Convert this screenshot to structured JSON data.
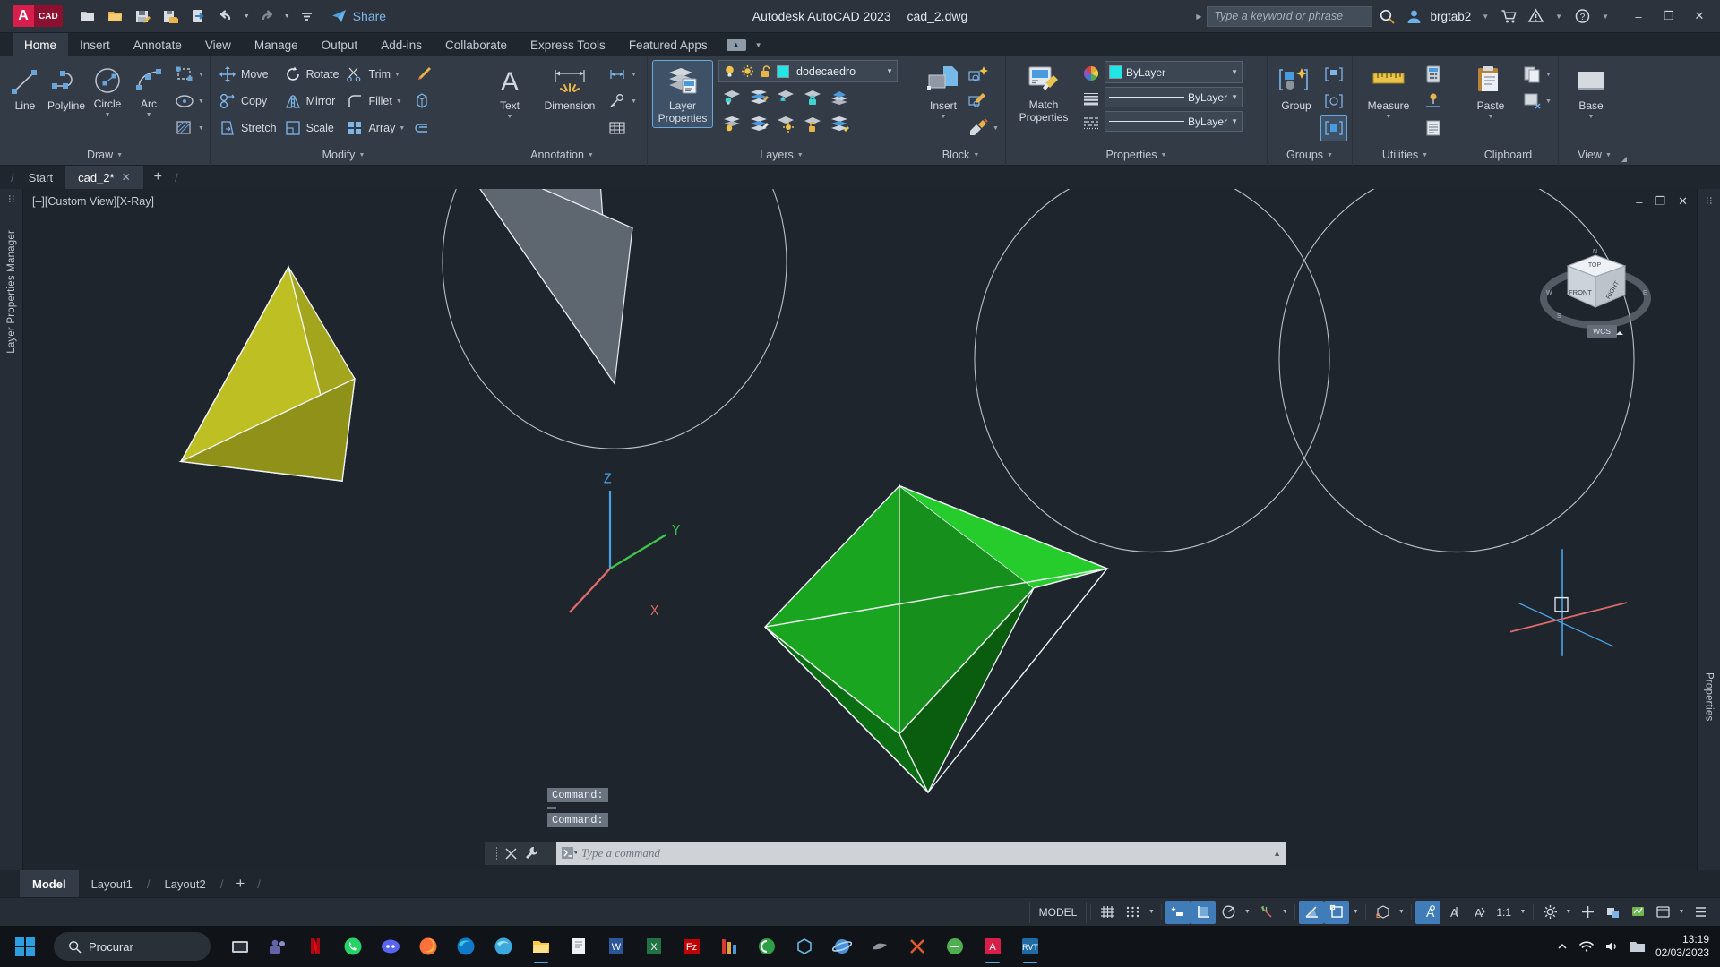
{
  "titlebar": {
    "logo_a": "A",
    "logo_cad": "CAD",
    "quick_access": [
      {
        "name": "new-icon",
        "tip": "New"
      },
      {
        "name": "open-icon",
        "tip": "Open"
      },
      {
        "name": "save-icon",
        "tip": "Save"
      },
      {
        "name": "save-as-icon",
        "tip": "Save As"
      },
      {
        "name": "plot-icon",
        "tip": "Plot"
      },
      {
        "name": "undo-icon",
        "tip": "Undo"
      },
      {
        "name": "redo-icon",
        "tip": "Redo"
      },
      {
        "name": "customize-icon",
        "tip": "Customize"
      }
    ],
    "share_label": "Share",
    "app_title": "Autodesk AutoCAD 2023",
    "file_name": "cad_2.dwg",
    "search_placeholder": "Type a keyword or phrase",
    "search_value": "",
    "user_name": "brgtab2",
    "window_buttons": {
      "minimize": "–",
      "maximize": "❐",
      "close": "✕"
    }
  },
  "ribbon_tabs": [
    {
      "label": "Home",
      "active": true
    },
    {
      "label": "Insert",
      "active": false
    },
    {
      "label": "Annotate",
      "active": false
    },
    {
      "label": "View",
      "active": false
    },
    {
      "label": "Manage",
      "active": false
    },
    {
      "label": "Output",
      "active": false
    },
    {
      "label": "Add-ins",
      "active": false
    },
    {
      "label": "Collaborate",
      "active": false
    },
    {
      "label": "Express Tools",
      "active": false
    },
    {
      "label": "Featured Apps",
      "active": false
    }
  ],
  "ribbon": {
    "draw": {
      "title": "Draw",
      "big": [
        {
          "label": "Line",
          "icon": "line-icon"
        },
        {
          "label": "Polyline",
          "icon": "polyline-icon"
        },
        {
          "label": "Circle",
          "icon": "circle-icon",
          "caret": true
        },
        {
          "label": "Arc",
          "icon": "arc-icon",
          "caret": true
        }
      ],
      "small": [
        {
          "icon": "rectangle-icon",
          "caret": true
        },
        {
          "icon": "ellipse-icon",
          "caret": true
        },
        {
          "icon": "hatch-icon",
          "caret": true
        }
      ]
    },
    "modify": {
      "title": "Modify",
      "items": [
        {
          "label": "Move",
          "icon": "move-icon"
        },
        {
          "label": "Rotate",
          "icon": "rotate-icon"
        },
        {
          "label": "Trim",
          "icon": "trim-icon",
          "caret": true
        },
        {
          "label": "Copy",
          "icon": "copy-icon"
        },
        {
          "label": "Mirror",
          "icon": "mirror-icon"
        },
        {
          "label": "Fillet",
          "icon": "fillet-icon",
          "caret": true
        },
        {
          "label": "Stretch",
          "icon": "stretch-icon"
        },
        {
          "label": "Scale",
          "icon": "scale-icon"
        },
        {
          "label": "Array",
          "icon": "array-icon",
          "caret": true
        }
      ],
      "extra": [
        {
          "icon": "erase-brush-icon"
        },
        {
          "icon": "solid-edit-icon"
        },
        {
          "icon": "join-icon"
        }
      ]
    },
    "annotation": {
      "title": "Annotation",
      "big": [
        {
          "label": "Text",
          "icon": "text-icon",
          "caret": true
        },
        {
          "label": "Dimension",
          "icon": "dimension-icon"
        }
      ],
      "small": [
        {
          "icon": "linear-dim-icon",
          "caret": true
        },
        {
          "icon": "leader-icon",
          "caret": true
        },
        {
          "icon": "table-icon"
        }
      ]
    },
    "layers": {
      "title": "Layers",
      "big": {
        "label": "Layer\nProperties",
        "label1": "Layer",
        "label2": "Properties",
        "icon": "layer-properties-icon",
        "active": true
      },
      "current_layer": "dodecaedro",
      "layer_color": "#22e6e6",
      "toggles": [
        {
          "icon": "lightbulb-icon",
          "state": "on"
        },
        {
          "icon": "sun-icon",
          "state": "on"
        },
        {
          "icon": "unlock-icon",
          "state": "unlocked"
        }
      ],
      "tools_row1": [
        {
          "icon": "layer-off-icon"
        },
        {
          "icon": "layer-isolate-icon"
        },
        {
          "icon": "layer-freeze-icon"
        },
        {
          "icon": "layer-lock-icon"
        },
        {
          "icon": "layer-make-current-icon"
        }
      ],
      "tools_row2": [
        {
          "icon": "layer-on-icon"
        },
        {
          "icon": "layer-unisolate-icon"
        },
        {
          "icon": "layer-thaw-icon"
        },
        {
          "icon": "layer-unlock-icon"
        },
        {
          "icon": "layer-match-icon"
        }
      ]
    },
    "block": {
      "title": "Block",
      "big": {
        "label": "Insert",
        "icon": "insert-block-icon",
        "caret": true
      },
      "small": [
        {
          "icon": "create-block-icon"
        },
        {
          "icon": "edit-block-icon"
        },
        {
          "icon": "edit-attribute-icon",
          "caret": true
        }
      ]
    },
    "properties": {
      "title": "Properties",
      "big": {
        "label1": "Match",
        "label2": "Properties",
        "icon": "match-properties-icon"
      },
      "color": {
        "icon": "color-wheel-icon",
        "swatch": "#22e6e6",
        "value": "ByLayer"
      },
      "linewidth": {
        "icon": "lineweight-icon",
        "value": "ByLayer"
      },
      "linetype": {
        "icon": "linetype-icon",
        "value": "ByLayer"
      }
    },
    "groups": {
      "title": "Groups",
      "big": {
        "label": "Group",
        "icon": "group-icon"
      },
      "small": [
        {
          "icon": "ungroup-icon"
        },
        {
          "icon": "group-edit-icon"
        },
        {
          "icon": "group-selection-icon",
          "active": true
        }
      ]
    },
    "utilities": {
      "title": "Utilities",
      "big": {
        "label": "Measure",
        "icon": "measure-icon",
        "caret": true
      },
      "small": [
        {
          "icon": "quick-calc-icon"
        },
        {
          "icon": "id-point-icon"
        },
        {
          "icon": "list-icon"
        }
      ]
    },
    "clipboard": {
      "title": "Clipboard",
      "big": {
        "label": "Paste",
        "icon": "paste-icon",
        "caret": true
      },
      "small": [
        {
          "icon": "copy-clip-icon",
          "caret": true
        },
        {
          "icon": "cut-clip-icon",
          "caret": true
        }
      ]
    },
    "view": {
      "title": "View",
      "big": {
        "label": "Base",
        "icon": "base-view-icon",
        "caret": true
      }
    }
  },
  "file_tabs": [
    {
      "label": "Start",
      "active": false,
      "closable": false
    },
    {
      "label": "cad_2*",
      "active": true,
      "closable": true
    }
  ],
  "file_tab_add": "+",
  "canvas": {
    "viewport_label": "[–][Custom View][X-Ray]",
    "viewport_controls": {
      "minimize": "–",
      "restore": "❐",
      "close": "✕"
    },
    "left_panel_label": "Layer Properties Manager",
    "right_panel_label": "Properties",
    "ucs_labels": {
      "x": "X",
      "y": "Y",
      "z": "Z"
    },
    "viewcube": {
      "top": "TOP",
      "front": "FRONT",
      "right": "RIGHT",
      "wcs": "WCS",
      "n": "N",
      "s": "S",
      "e": "E",
      "w": "W"
    },
    "command_history": [
      "Command:",
      "Command:",
      "Command:"
    ],
    "command_placeholder": "Type a command",
    "command_value": ""
  },
  "layout_tabs": [
    {
      "label": "Model",
      "active": true
    },
    {
      "label": "Layout1",
      "active": false
    },
    {
      "label": "Layout2",
      "active": false
    }
  ],
  "layout_add": "+",
  "statusbar": {
    "model_label": "MODEL",
    "scale": "1:1",
    "buttons": [
      {
        "name": "grid-display-toggle",
        "on": false
      },
      {
        "name": "snap-mode-toggle",
        "on": false
      },
      {
        "name": "infer-constraints-toggle",
        "on": true
      },
      {
        "name": "ortho-mode-toggle",
        "on": true
      },
      {
        "name": "polar-tracking-toggle",
        "on": false
      },
      {
        "name": "object-snap-tracking-toggle",
        "on": false
      },
      {
        "name": "dynamic-ucs-toggle",
        "on": true
      },
      {
        "name": "object-snap-toggle",
        "on": true
      },
      {
        "name": "3d-object-snap-toggle",
        "on": false
      },
      {
        "name": "annotation-visibility-toggle",
        "on": true
      },
      {
        "name": "autoscale-toggle",
        "on": false
      },
      {
        "name": "annotation-scale-toggle",
        "on": false
      },
      {
        "name": "workspace-switching",
        "on": false
      },
      {
        "name": "hardware-acceleration",
        "on": false
      },
      {
        "name": "isolate-objects",
        "on": false
      },
      {
        "name": "clean-screen",
        "on": false
      },
      {
        "name": "customization",
        "on": false
      }
    ]
  },
  "taskbar": {
    "search_label": "Procurar",
    "apps": [
      {
        "name": "task-view",
        "color": "#cfd4da"
      },
      {
        "name": "teams-app",
        "color": "#6264a7"
      },
      {
        "name": "netflix-app",
        "color": "#e50914"
      },
      {
        "name": "whatsapp-app",
        "color": "#25d366"
      },
      {
        "name": "discord-app",
        "color": "#5865f2"
      },
      {
        "name": "firefox-app",
        "color": "#ff7139"
      },
      {
        "name": "edge-app",
        "color": "#0f7ac8"
      },
      {
        "name": "edge-dev-app",
        "color": "#3ca9de"
      },
      {
        "name": "file-explorer-app",
        "color": "#ffc83d"
      },
      {
        "name": "notepad-app",
        "color": "#e8eaed"
      },
      {
        "name": "word-app",
        "color": "#2b579a"
      },
      {
        "name": "excel-app",
        "color": "#217346"
      },
      {
        "name": "filezilla-app",
        "color": "#bf0000"
      },
      {
        "name": "media-app",
        "color": "#d63b2f"
      },
      {
        "name": "qbittorrent-app",
        "color": "#2f9e44"
      },
      {
        "name": "sketchup-app",
        "color": "#69b4e0"
      },
      {
        "name": "planet-app",
        "color": "#4a90d9"
      },
      {
        "name": "grey-app",
        "color": "#8d949d"
      },
      {
        "name": "cut-app",
        "color": "#e05a2b"
      },
      {
        "name": "python-app",
        "color": "#4fae4f"
      },
      {
        "name": "autocad-app",
        "color": "#d81e4a",
        "active": true
      },
      {
        "name": "revit-app",
        "color": "#1e6ba8",
        "active": true
      }
    ],
    "clock_time": "13:19",
    "clock_date": "02/03/2023"
  },
  "colors": {
    "accent": "#3f7cb8",
    "ribbon_bg": "#333b46",
    "window_bg": "#20262e",
    "canvas_bg": "#1f252c",
    "tetra_light": "#b5b81f",
    "tetra_dark": "#8d9017",
    "octa_light": "#1fb825",
    "octa_mid": "#0c8c18",
    "octa_dark": "#0b5f12",
    "grey_face": "#6e7781"
  }
}
